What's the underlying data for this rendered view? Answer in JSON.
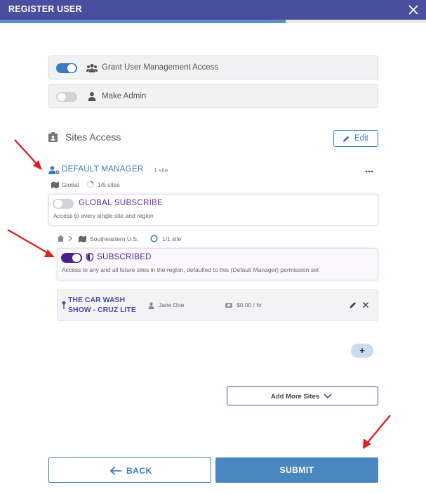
{
  "header": {
    "title": "REGISTER USER",
    "progress_fraction": 0.67,
    "colors": {
      "header_bg": "#4a4e9e",
      "progress": "#5b90c4"
    }
  },
  "permissions": [
    {
      "label": "Grant User Management Access",
      "enabled": true,
      "icon": "users-icon"
    },
    {
      "label": "Make Admin",
      "enabled": false,
      "icon": "user-icon"
    }
  ],
  "sites_access": {
    "title": "Sites Access",
    "edit_label": "Edit",
    "role": {
      "name": "DEFAULT MANAGER",
      "count": "1 site",
      "scope_label": "Global",
      "scope_count": "1/5 sites"
    },
    "global_subscribe": {
      "title": "GLOBAL SUBSCRIBE",
      "enabled": false,
      "description": "Access to every single site and region"
    },
    "region": {
      "name": "Southeastern U.S.",
      "count": "1/1 site"
    },
    "subscribed": {
      "title": "SUBSCRIBED",
      "enabled": true,
      "description": "Access to any and all future sites in the region, defaulted to this (Default Manager) permission set"
    },
    "site": {
      "name": "THE CAR WASH SHOW - CRUZ LITE",
      "user": "Jane Doe",
      "rate": "$0.00 / hr"
    },
    "add_label": "+",
    "add_more_label": "Add More Sites"
  },
  "footer": {
    "back_label": "BACK",
    "submit_label": "SUBMIT"
  },
  "colors": {
    "accent": "#3a7bbd",
    "purple": "#4b1f8f",
    "annotation_arrow": "#e02020"
  }
}
